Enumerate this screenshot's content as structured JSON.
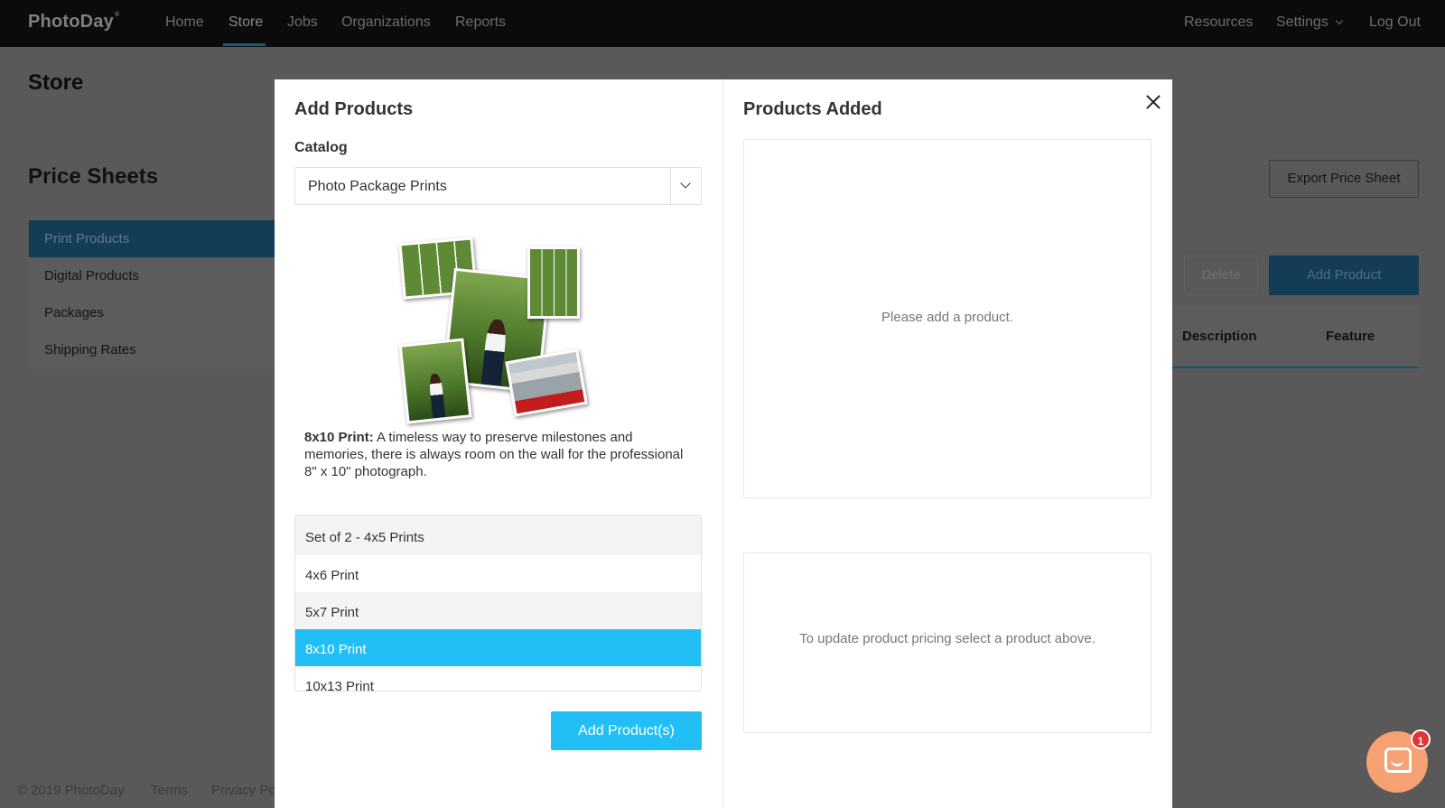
{
  "topnav": {
    "brand": "PhotoDay",
    "links": [
      "Home",
      "Store",
      "Jobs",
      "Organizations",
      "Reports"
    ],
    "active": "Store",
    "right_links": {
      "resources": "Resources",
      "settings": "Settings",
      "logout": "Log Out"
    }
  },
  "page": {
    "title": "Store",
    "price_sheets_title": "Price Sheets",
    "sidebar": [
      "Print Products",
      "Digital Products",
      "Packages",
      "Shipping Rates"
    ],
    "buttons": {
      "export": "Export Price Sheet",
      "delete": "Delete",
      "add": "Add Product"
    },
    "table_headers": [
      "Description",
      "Feature"
    ],
    "footer": {
      "copyright": "© 2019 PhotoDay",
      "terms": "Terms",
      "privacy": "Privacy Po"
    }
  },
  "modal": {
    "left_title": "Add Products",
    "catalog_label": "Catalog",
    "catalog_value": "Photo Package Prints",
    "description_bold": "8x10 Print:",
    "description_text": " A timeless way to preserve milestones and memories, there is always room on the wall for the professional 8\" x 10\" photograph.",
    "products": [
      "Set of 2 - 4x5 Prints",
      "4x6 Print",
      "5x7 Print",
      "8x10 Print",
      "10x13 Print"
    ],
    "selected_product": "8x10 Print",
    "add_button": "Add Product(s)",
    "right_title": "Products Added",
    "empty_added": "Please add a product.",
    "pricing_hint": "To update product pricing select a product above."
  },
  "chat": {
    "badge_count": "1"
  }
}
